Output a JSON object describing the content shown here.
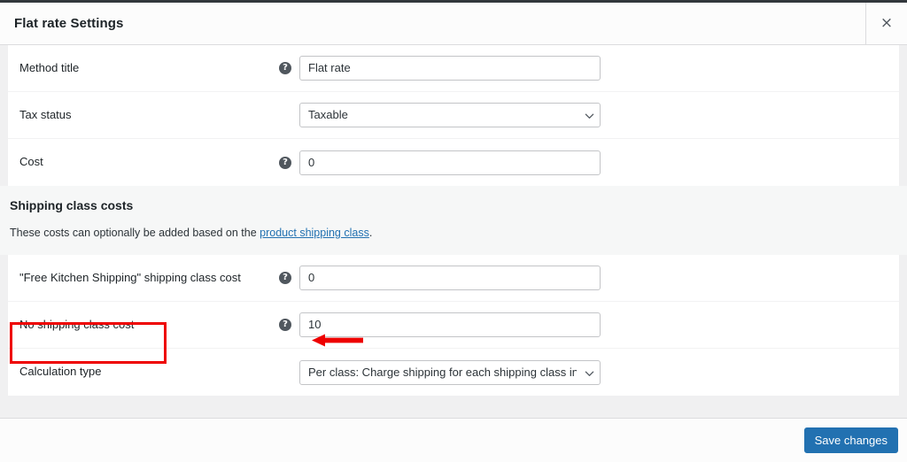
{
  "modal": {
    "title": "Flat rate Settings",
    "close_icon": "close-icon",
    "close_label": "×"
  },
  "form": {
    "rows": [
      {
        "label": "Method title",
        "has_helptip": true,
        "control": "text",
        "value": "Flat rate"
      },
      {
        "label": "Tax status",
        "has_helptip": false,
        "control": "select",
        "value": "Taxable"
      },
      {
        "label": "Cost",
        "has_helptip": true,
        "control": "text",
        "value": "0"
      }
    ]
  },
  "shipping_class_section": {
    "heading": "Shipping class costs",
    "description_before": "These costs can optionally be added based on the ",
    "link_text": "product shipping class",
    "description_after": "."
  },
  "class_rows": [
    {
      "label": "\"Free Kitchen Shipping\" shipping class cost",
      "has_helptip": true,
      "control": "text",
      "value": "0",
      "highlighted": false
    },
    {
      "label": "No shipping class cost",
      "has_helptip": true,
      "control": "text",
      "value": "10",
      "highlighted": true
    },
    {
      "label": "Calculation type",
      "has_helptip": false,
      "control": "select",
      "value": "Per class: Charge shipping for each shipping class individually",
      "highlighted": false
    }
  ],
  "footer": {
    "save_label": "Save changes"
  },
  "annotations": {
    "highlight_color": "#ee0000",
    "arrow_direction": "left",
    "arrow_target": "No shipping class cost value field"
  },
  "colors": {
    "accent": "#2271b1",
    "page_background": "#f0f0f1",
    "band_background": "#f6f7f7",
    "text": "#1d2327",
    "border": "#c3c4c7",
    "annotation_red": "#ee0000"
  },
  "icons": {
    "helptip": "?",
    "chevron_down": "chevron-down-icon"
  }
}
